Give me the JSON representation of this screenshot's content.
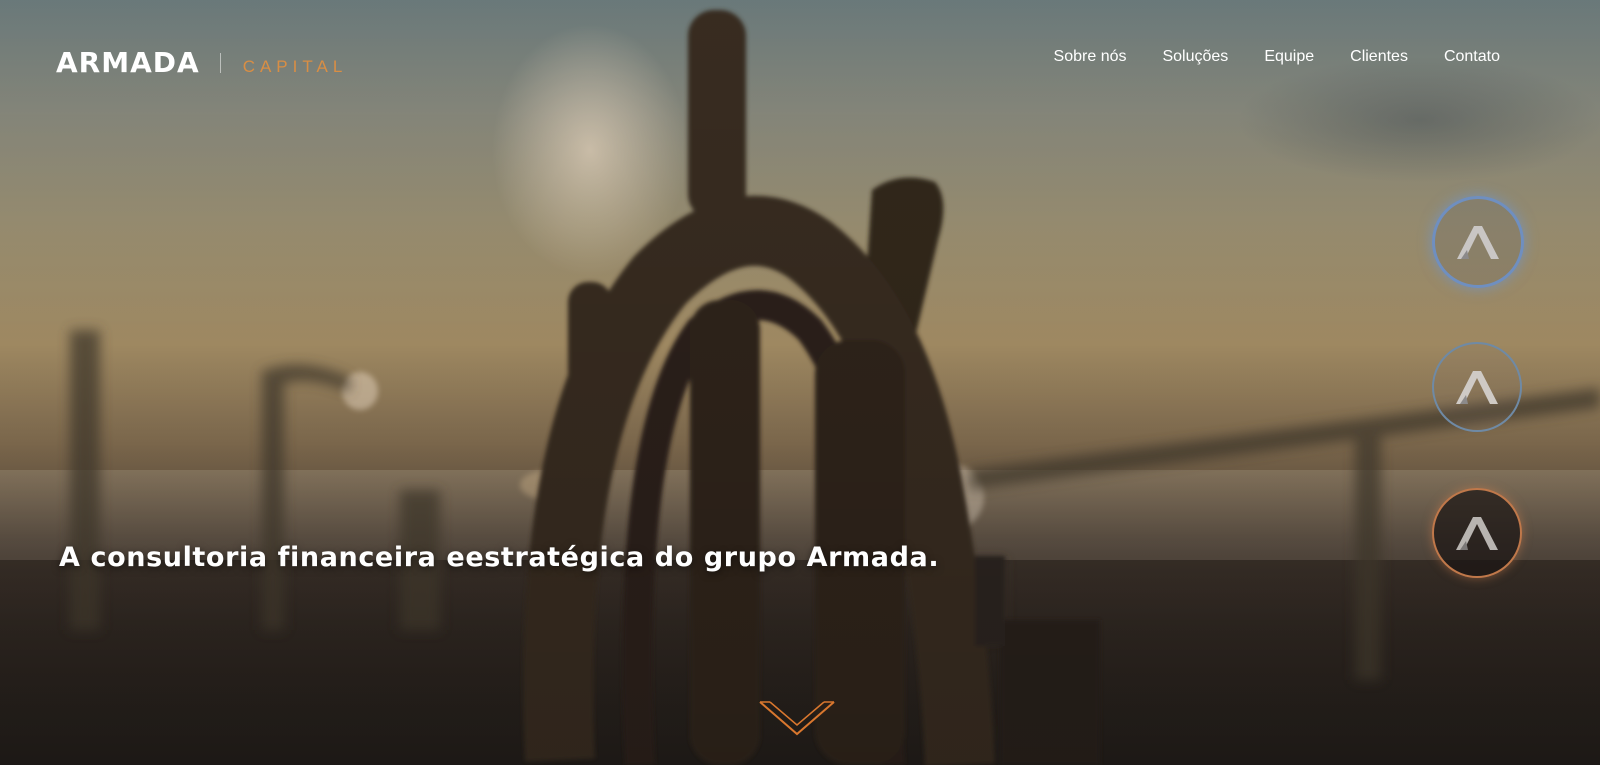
{
  "header": {
    "logo_main": "ARMADA",
    "logo_sub": "CAPITAL",
    "nav": [
      "Sobre nós",
      "Soluções",
      "Equipe",
      "Clientes",
      "Contato"
    ]
  },
  "hero": {
    "tagline": "A consultoria financeira eestratégica do grupo Armada."
  },
  "slider": {
    "items": [
      "slide-1",
      "slide-2",
      "slide-3"
    ],
    "active_index": 0
  },
  "colors": {
    "accent": "#d98e44",
    "active_ring": "#6f8fc0",
    "inactive_ring": "#6f8aa5",
    "orange_ring": "#c0784a"
  },
  "icons": {
    "slide_icon": "armada-chevron-up-icon",
    "scroll": "chevron-down-icon"
  }
}
